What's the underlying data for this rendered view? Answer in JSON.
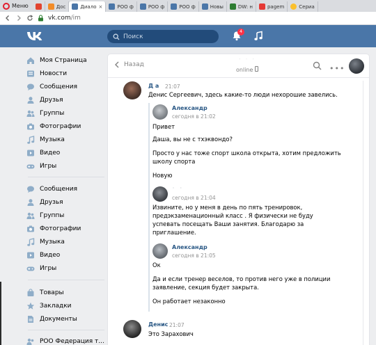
{
  "browser": {
    "menu_label": "Меню",
    "tabs": [
      {
        "label": "",
        "icon": "yandex-b-icon",
        "color": "#e2442f"
      },
      {
        "label": "Дос",
        "icon": "yandex-money-icon",
        "color": "#f28c28"
      },
      {
        "label": "Диало",
        "icon": "vk-icon",
        "color": "#4a76a8",
        "active": true
      },
      {
        "label": "РОО ф",
        "icon": "vk-icon",
        "color": "#4a76a8"
      },
      {
        "label": "РОО ф",
        "icon": "vk-icon",
        "color": "#4a76a8"
      },
      {
        "label": "РОО ф",
        "icon": "vk-icon",
        "color": "#4a76a8"
      },
      {
        "label": "Новы",
        "icon": "vk-icon",
        "color": "#4a76a8"
      },
      {
        "label": "DW: н",
        "icon": "dw-icon",
        "color": "#2e7d32"
      },
      {
        "label": "pagem",
        "icon": "yandex-icon",
        "color": "#e53935"
      },
      {
        "label": "Сериа",
        "icon": "play-icon",
        "color": "#fbc02d"
      }
    ],
    "close_glyph": "×",
    "url_host": "vk.com",
    "url_path": "/im"
  },
  "header": {
    "search_placeholder": "Поиск",
    "notifications_count": "4"
  },
  "sidebar": {
    "group1": [
      {
        "label": "Моя Страница",
        "icon": "home-icon"
      },
      {
        "label": "Новости",
        "icon": "news-icon"
      },
      {
        "label": "Сообщения",
        "icon": "messages-icon"
      },
      {
        "label": "Друзья",
        "icon": "friends-icon"
      },
      {
        "label": "Группы",
        "icon": "groups-icon"
      },
      {
        "label": "Фотографии",
        "icon": "camera-icon"
      },
      {
        "label": "Музыка",
        "icon": "music-icon"
      },
      {
        "label": "Видео",
        "icon": "video-icon"
      },
      {
        "label": "Игры",
        "icon": "gamepad-icon"
      }
    ],
    "group2": [
      {
        "label": "Сообщения",
        "icon": "messages-icon"
      },
      {
        "label": "Друзья",
        "icon": "friends-icon"
      },
      {
        "label": "Группы",
        "icon": "groups-icon"
      },
      {
        "label": "Фотографии",
        "icon": "camera-icon"
      },
      {
        "label": "Музыка",
        "icon": "music-icon"
      },
      {
        "label": "Видео",
        "icon": "video-icon"
      },
      {
        "label": "Игры",
        "icon": "gamepad-icon"
      }
    ],
    "group3": [
      {
        "label": "Товары",
        "icon": "shopping-bag-icon"
      },
      {
        "label": "Закладки",
        "icon": "star-icon"
      },
      {
        "label": "Документы",
        "icon": "document-icon"
      }
    ],
    "group4": [
      {
        "label": "РОО Федерация т...",
        "icon": "community-icon"
      }
    ]
  },
  "dialog": {
    "back_label": "Назад",
    "peer_name": "˙ ˙ ˙",
    "peer_status": "online",
    "messages": [
      {
        "author": "Д  а",
        "time": "21:07",
        "text": "Денис Сергеевич, здесь какие-то люди нехорошие завелись.",
        "forwarded": [
          {
            "author": "Александр",
            "time": "сегодня в 21:02",
            "paragraphs": [
              "Привет",
              "Даша, вы не с тхэквондо?",
              "Просто у нас тоже спорт школа открыта, хотим предложить школу спорта",
              "Новую"
            ]
          },
          {
            "author": "˙ ˙",
            "time": "сегодня в 21:04",
            "paragraphs": [
              "Извините, но у меня в день по пять тренировок, предэкзаменационный класс . Я физически не буду успевать посещать Ваши занятия. Благодарю за приглашение."
            ]
          },
          {
            "author": "Александр",
            "time": "сегодня в 21:05",
            "paragraphs": [
              "Ок",
              "Да и если тренер веселов, то против него уже в полиции заявление, секция будет закрыта.",
              "Он работает незаконно"
            ]
          }
        ]
      },
      {
        "author": "Денис",
        "time": "21:07",
        "text": "Это Зарахович"
      }
    ]
  }
}
